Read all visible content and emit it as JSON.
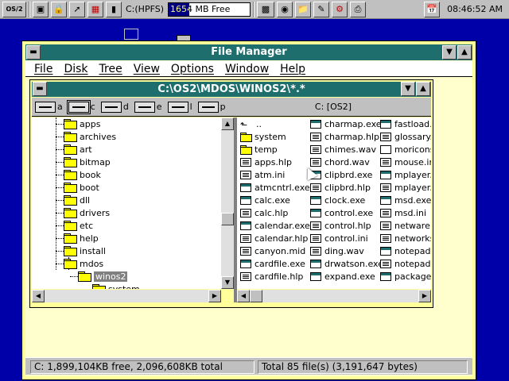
{
  "topbar": {
    "os2_logo": "OS/2",
    "drive": "C:(HPFS)",
    "free_space": "1654 MB Free",
    "free_space_fraction": 0.25,
    "time": "08:46:52 AM",
    "icons": [
      "os2-logo-icon",
      "window-list-icon",
      "lock-icon",
      "pointer-tool-icon",
      "system-monitor-icon",
      "battery-icon",
      "drive-icon",
      "ram-icon",
      "cube-icon",
      "folder-icon",
      "notebook-icon",
      "gear-icon",
      "printer-icon",
      "calendar-icon"
    ]
  },
  "window": {
    "title": "File Manager",
    "menu": [
      "File",
      "Disk",
      "Tree",
      "View",
      "Options",
      "Window",
      "Help"
    ]
  },
  "child": {
    "title": "C:\\OS2\\MDOS\\WINOS2\\*.*",
    "drives": [
      "a",
      "c",
      "d",
      "e",
      "l",
      "p"
    ],
    "selected_drive": "c",
    "volume": "C: [OS2]"
  },
  "tree": {
    "folders": [
      "apps",
      "archives",
      "art",
      "bitmap",
      "book",
      "boot",
      "dll",
      "drivers",
      "etc",
      "help",
      "install",
      "mdos",
      "winos2",
      "system"
    ],
    "selected": "winos2"
  },
  "files": {
    "col1": [
      {
        "name": "..",
        "type": "up"
      },
      {
        "name": "system",
        "type": "dir"
      },
      {
        "name": "temp",
        "type": "dir"
      },
      {
        "name": "apps.hlp",
        "type": "doc"
      },
      {
        "name": "atm.ini",
        "type": "doc"
      },
      {
        "name": "atmcntrl.exe",
        "type": "exe"
      },
      {
        "name": "calc.exe",
        "type": "exe"
      },
      {
        "name": "calc.hlp",
        "type": "doc"
      },
      {
        "name": "calendar.exe",
        "type": "exe"
      },
      {
        "name": "calendar.hlp",
        "type": "doc"
      },
      {
        "name": "canyon.mid",
        "type": "doc"
      },
      {
        "name": "cardfile.exe",
        "type": "exe"
      },
      {
        "name": "cardfile.hlp",
        "type": "doc"
      }
    ],
    "col2": [
      {
        "name": "charmap.exe",
        "type": "exe"
      },
      {
        "name": "charmap.hlp",
        "type": "doc"
      },
      {
        "name": "chimes.wav",
        "type": "doc"
      },
      {
        "name": "chord.wav",
        "type": "doc"
      },
      {
        "name": "clipbrd.exe",
        "type": "exe"
      },
      {
        "name": "clipbrd.hlp",
        "type": "doc"
      },
      {
        "name": "clock.exe",
        "type": "exe"
      },
      {
        "name": "control.exe",
        "type": "exe"
      },
      {
        "name": "control.hlp",
        "type": "doc"
      },
      {
        "name": "control.ini",
        "type": "doc"
      },
      {
        "name": "ding.wav",
        "type": "doc"
      },
      {
        "name": "drwatson.exe",
        "type": "exe"
      },
      {
        "name": "expand.exe",
        "type": "exe"
      }
    ],
    "col3": [
      {
        "name": "fastload.",
        "type": "exe"
      },
      {
        "name": "glossary.",
        "type": "doc"
      },
      {
        "name": "moricons",
        "type": "plain"
      },
      {
        "name": "mouse.in",
        "type": "doc"
      },
      {
        "name": "mplayer.",
        "type": "exe"
      },
      {
        "name": "mplayer.",
        "type": "doc"
      },
      {
        "name": "msd.exe",
        "type": "exe"
      },
      {
        "name": "msd.ini",
        "type": "doc"
      },
      {
        "name": "netware.",
        "type": "doc"
      },
      {
        "name": "networks",
        "type": "doc"
      },
      {
        "name": "notepad",
        "type": "exe"
      },
      {
        "name": "notepad",
        "type": "doc"
      },
      {
        "name": "package",
        "type": "exe"
      }
    ]
  },
  "status": {
    "left": "C: 1,899,104KB free,  2,096,608KB total",
    "right": "Total 85 file(s) (3,191,647 bytes)"
  }
}
